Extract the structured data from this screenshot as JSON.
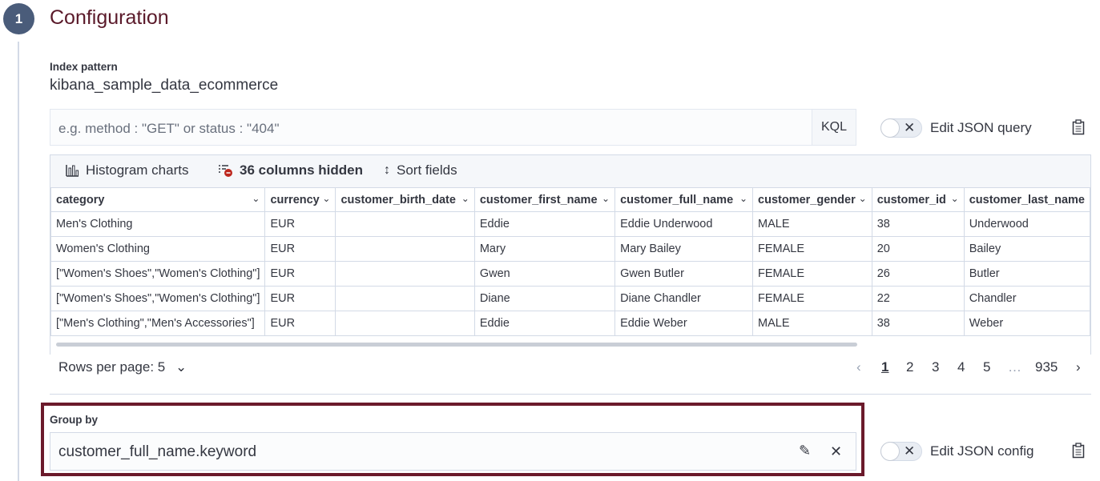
{
  "step": {
    "number": "1",
    "title": "Configuration"
  },
  "index_pattern": {
    "label": "Index pattern",
    "value": "kibana_sample_data_ecommerce"
  },
  "query": {
    "placeholder": "e.g. method : \"GET\" or status : \"404\"",
    "value": "",
    "language": "KQL"
  },
  "edit_json_query": {
    "label": "Edit JSON query",
    "enabled": false
  },
  "grid_toolbar": {
    "histogram": "Histogram charts",
    "columns_hidden": "36 columns hidden",
    "sort": "Sort fields"
  },
  "table": {
    "columns": [
      "category",
      "currency",
      "customer_birth_date",
      "customer_first_name",
      "customer_full_name",
      "customer_gender",
      "customer_id",
      "customer_last_name"
    ],
    "rows": [
      [
        "Men's Clothing",
        "EUR",
        "",
        "Eddie",
        "Eddie Underwood",
        "MALE",
        "38",
        "Underwood"
      ],
      [
        "Women's Clothing",
        "EUR",
        "",
        "Mary",
        "Mary Bailey",
        "FEMALE",
        "20",
        "Bailey"
      ],
      [
        "[\"Women's Shoes\",\"Women's Clothing\"]",
        "EUR",
        "",
        "Gwen",
        "Gwen Butler",
        "FEMALE",
        "26",
        "Butler"
      ],
      [
        "[\"Women's Shoes\",\"Women's Clothing\"]",
        "EUR",
        "",
        "Diane",
        "Diane Chandler",
        "FEMALE",
        "22",
        "Chandler"
      ],
      [
        "[\"Men's Clothing\",\"Men's Accessories\"]",
        "EUR",
        "",
        "Eddie",
        "Eddie Weber",
        "MALE",
        "38",
        "Weber"
      ]
    ]
  },
  "pagination": {
    "rows_per_page": "Rows per page: 5",
    "pages": [
      "1",
      "2",
      "3",
      "4",
      "5"
    ],
    "ellipsis": "…",
    "last": "935",
    "current": "1"
  },
  "group_by": {
    "label": "Group by",
    "value": "customer_full_name.keyword"
  },
  "edit_json_config": {
    "label": "Edit JSON config",
    "enabled": false
  },
  "colors": {
    "accent": "#5a1a2a",
    "highlight_border": "#6b1a2b",
    "step": "#4a5c7a"
  }
}
